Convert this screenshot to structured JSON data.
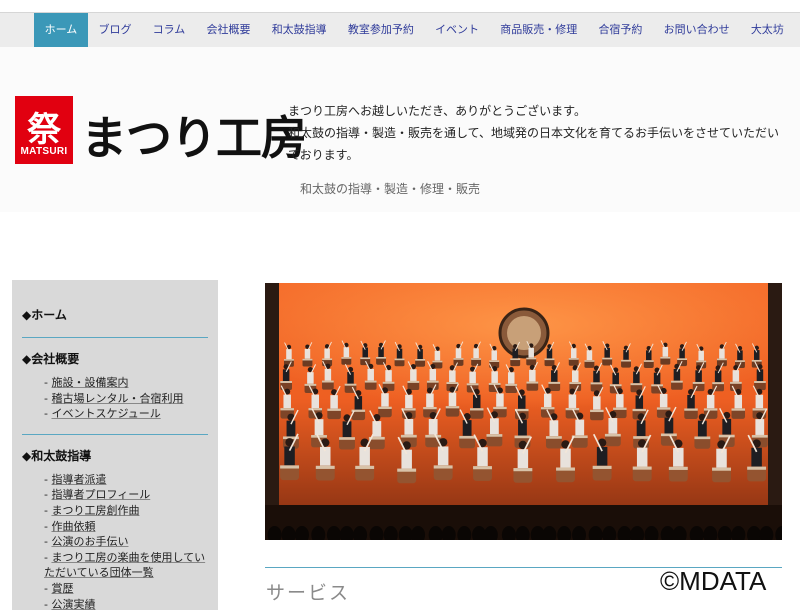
{
  "nav": {
    "items": [
      {
        "label": "ホーム",
        "active": true
      },
      {
        "label": "ブログ"
      },
      {
        "label": "コラム"
      },
      {
        "label": "会社概要"
      },
      {
        "label": "和太鼓指導"
      },
      {
        "label": "教室参加予約"
      },
      {
        "label": "イベント"
      },
      {
        "label": "商品販売・修理"
      },
      {
        "label": "合宿予約"
      },
      {
        "label": "お問い合わせ"
      },
      {
        "label": "大太坊"
      }
    ]
  },
  "header": {
    "logo_kanji": "祭",
    "logo_sub": "MATSURI",
    "logo_name": "まつり工房",
    "intro": "まつり工房へお越しいただき、ありがとうございます。\n和太鼓の指導・製造・販売を通して、地域発の日本文化を育てるお手伝いをさせていただいております。",
    "tagline": "和太鼓の指導・製造・修理・販売"
  },
  "sidebar": {
    "sections": [
      {
        "heading": "◆ホーム",
        "items": []
      },
      {
        "heading": "◆会社概要",
        "items": [
          "施設・設備案内",
          "稽古場レンタル・合宿利用",
          "イベントスケジュール"
        ]
      },
      {
        "heading": "◆和太鼓指導",
        "items": [
          "指導者派遣",
          "指導者プロフィール",
          "まつり工房創作曲",
          "作曲依頼",
          "公演のお手伝い",
          "まつり工房の楽曲を使用していただいている団体一覧",
          "賞歴",
          "公演実績"
        ]
      }
    ]
  },
  "main": {
    "section_title": "サービス"
  },
  "watermark": "©MDATA",
  "colors": {
    "nav_active": "#3b98b8",
    "nav_text": "#2f3b9a",
    "logo_red": "#e10010",
    "accent_rule": "#5aa7c2",
    "stage_orange": "#f2682a"
  }
}
